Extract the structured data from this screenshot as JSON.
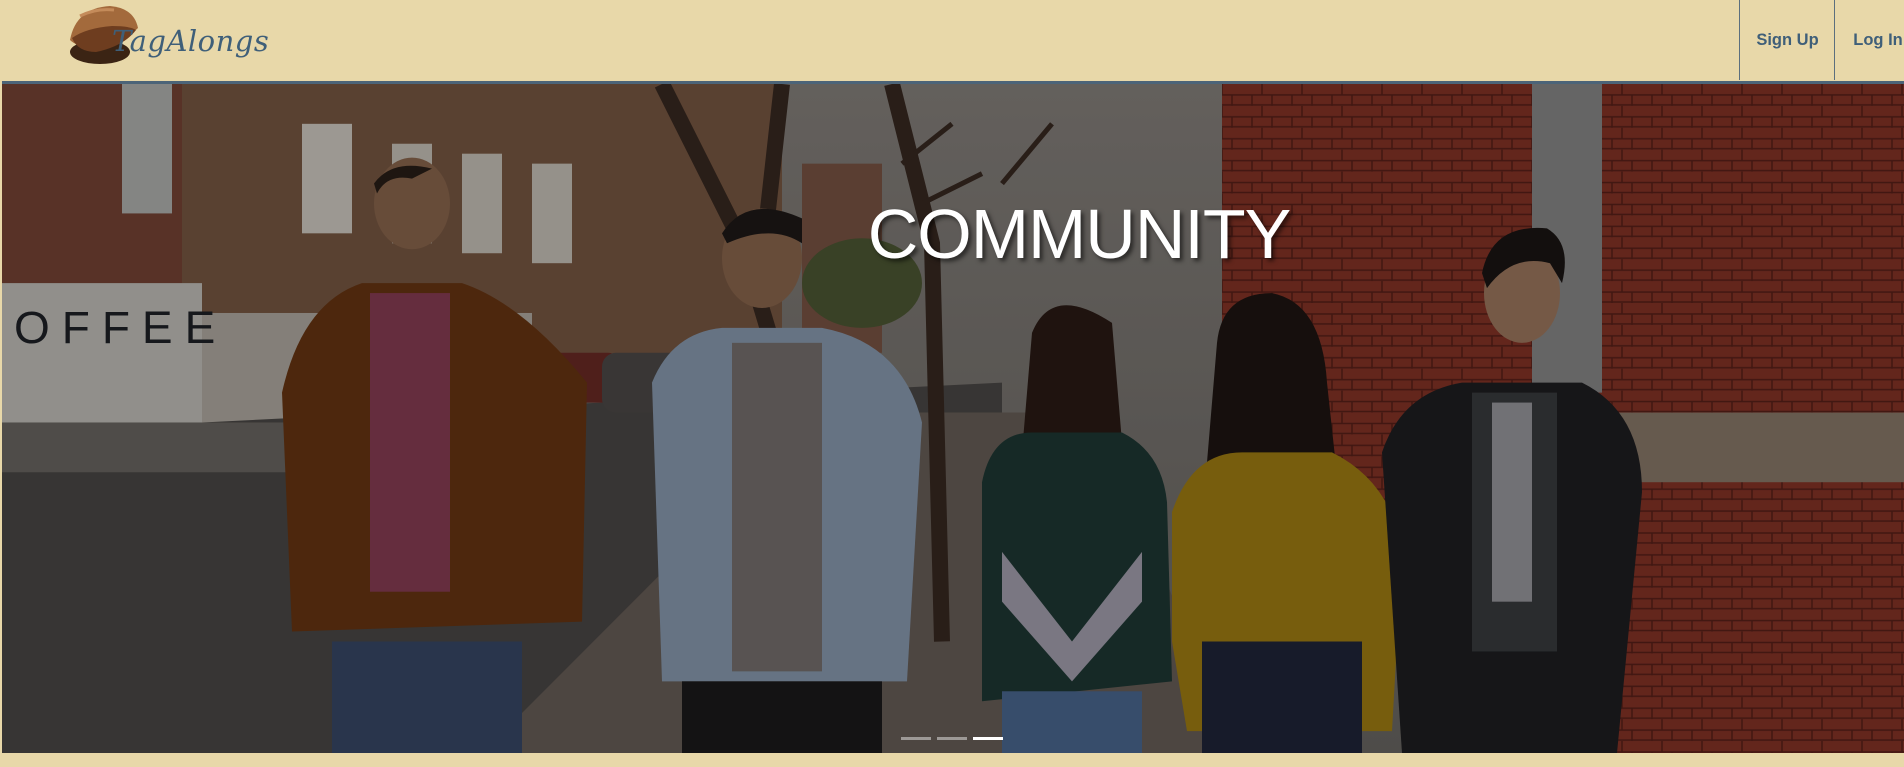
{
  "brand": {
    "name": "TagAlongs"
  },
  "nav": {
    "signup_label": "Sign Up",
    "login_label": "Log In"
  },
  "hero": {
    "title": "COMMUNITY",
    "slide_count": 3,
    "active_slide": 3,
    "storefront_sign": "OFFEE"
  },
  "colors": {
    "nav_background": "#e8d8a9",
    "brand_text": "#3f5f79",
    "hero_border": "#4c6478",
    "indicator_active": "#ffffff"
  }
}
